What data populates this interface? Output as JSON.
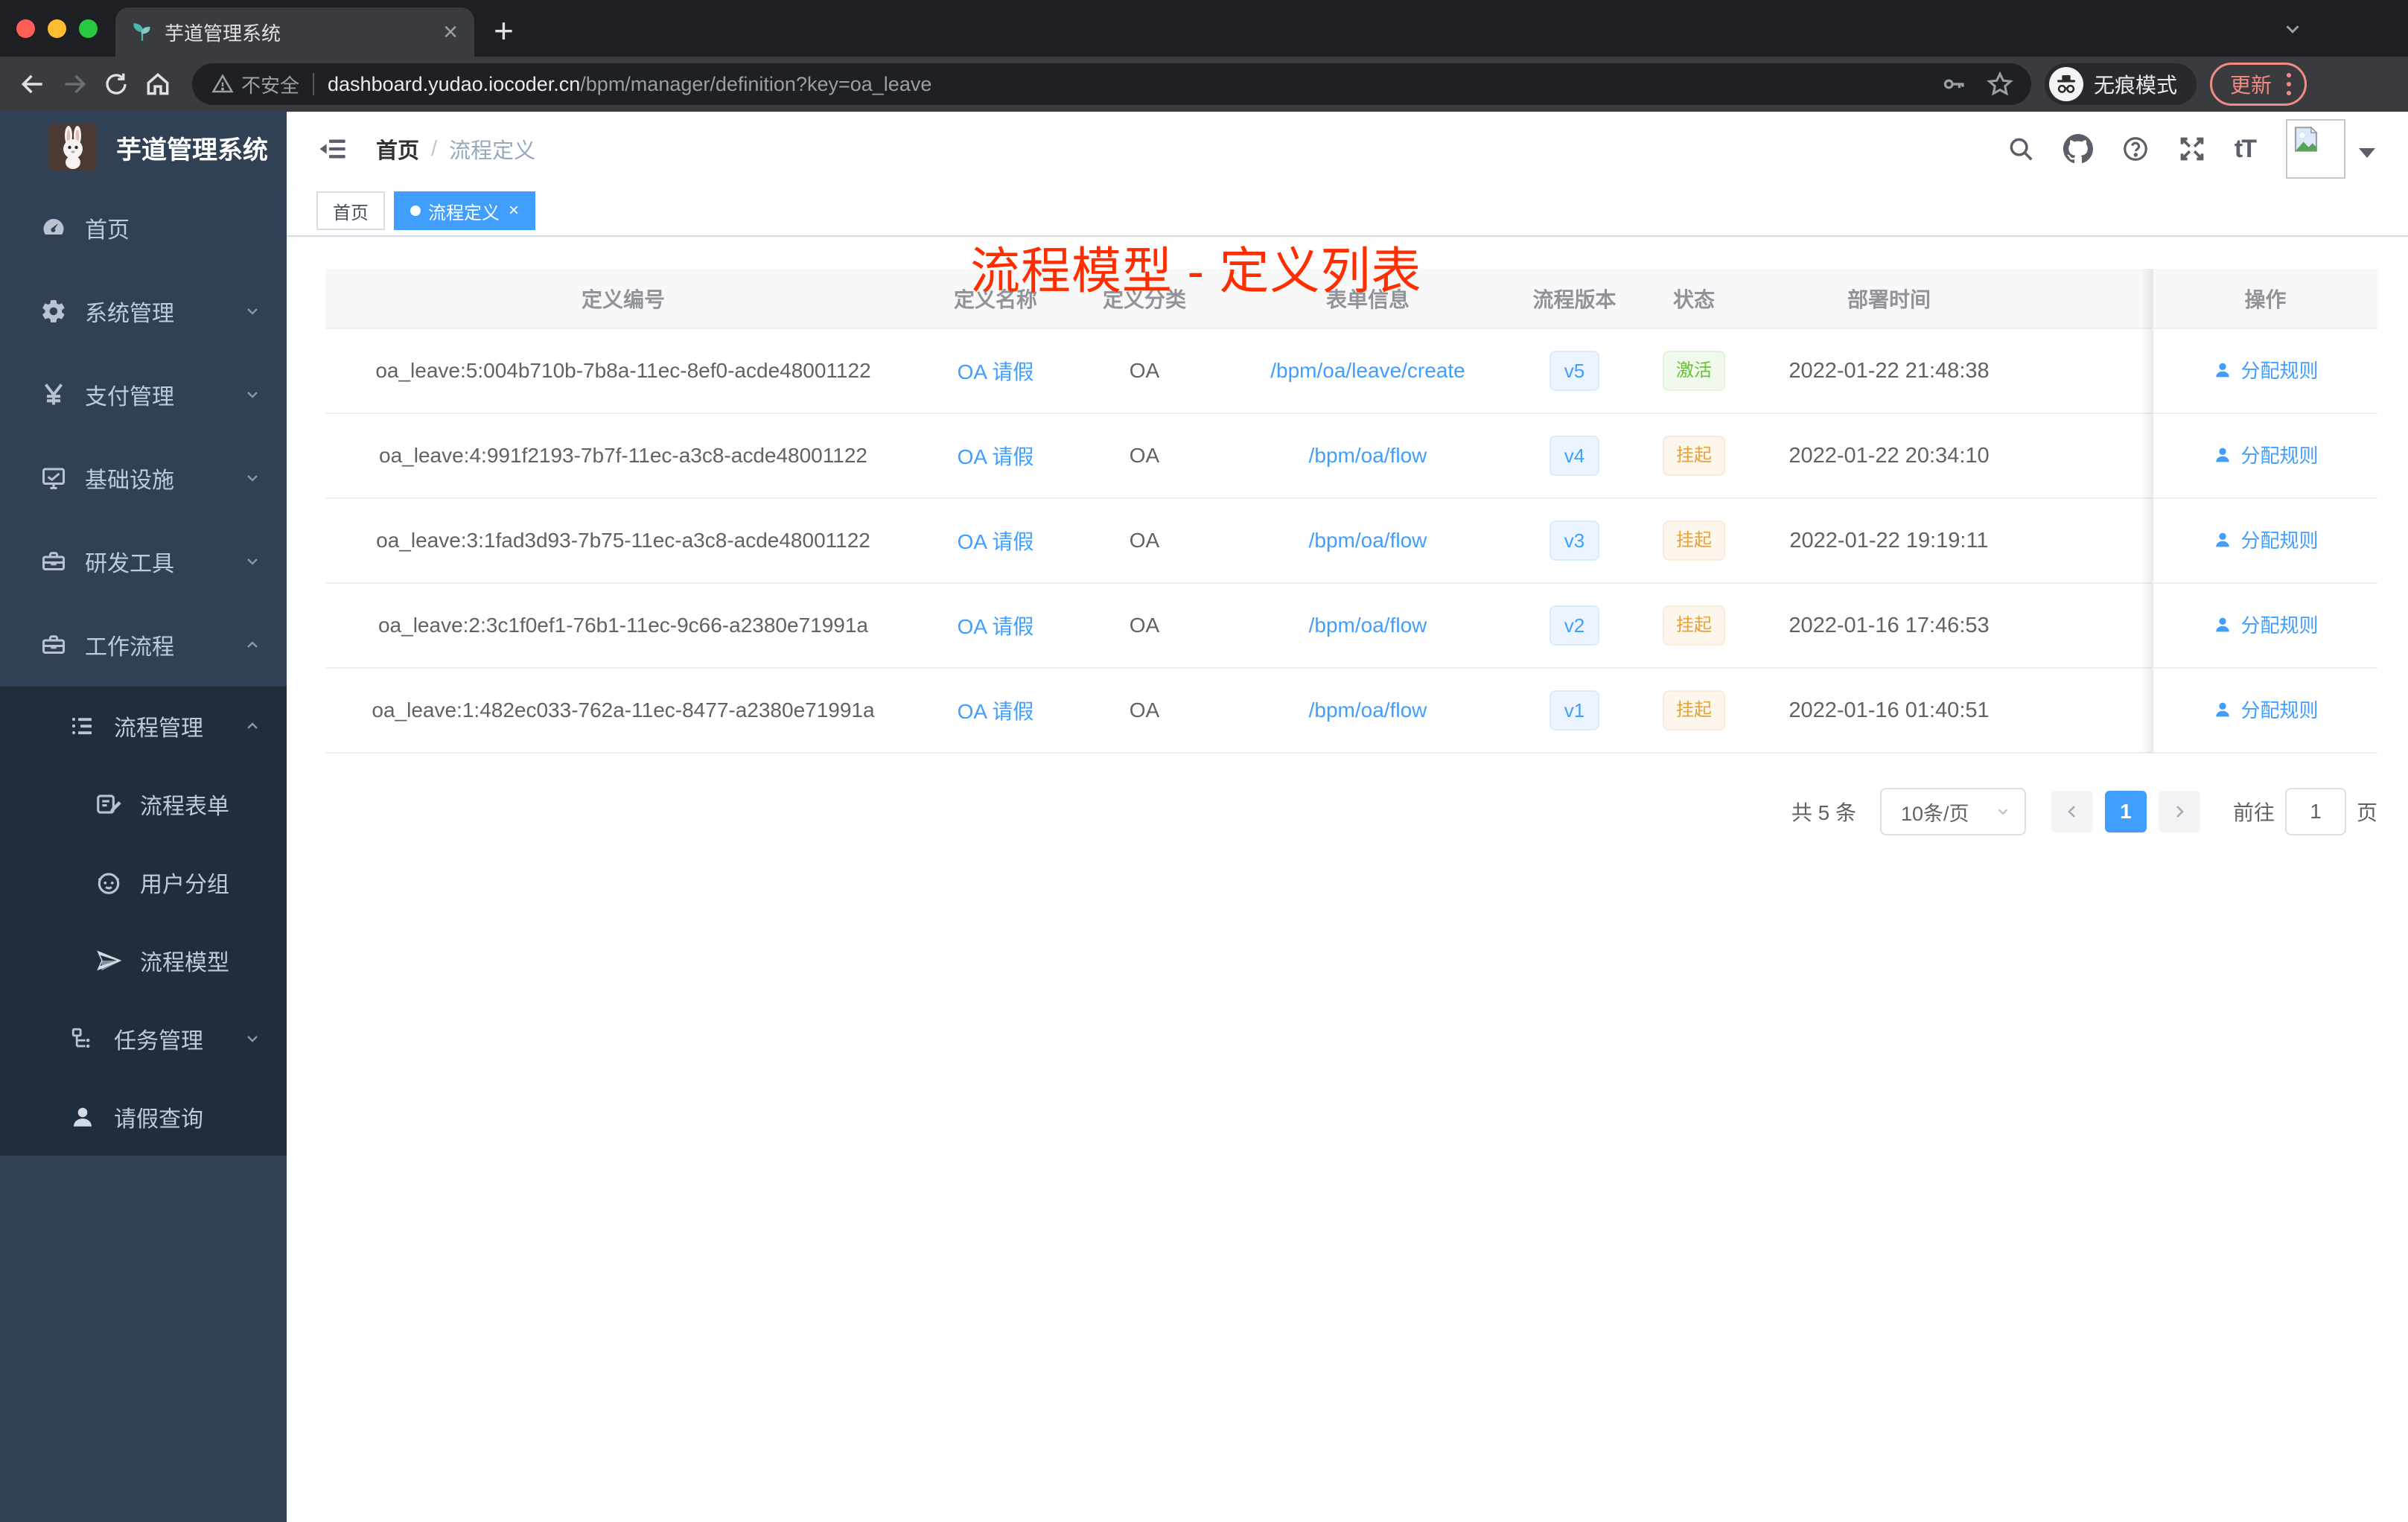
{
  "browser": {
    "tab_title": "芋道管理系统",
    "new_tab_glyph": "+",
    "close_glyph": "×",
    "security_label": "不安全",
    "url_host": "dashboard.yudao.iocoder.cn",
    "url_path": "/bpm/manager/definition?key=oa_leave",
    "incognito_label": "无痕模式",
    "update_label": "更新"
  },
  "sidebar": {
    "logo_title": "芋道管理系统",
    "items": [
      {
        "label": "首页"
      },
      {
        "label": "系统管理"
      },
      {
        "label": "支付管理"
      },
      {
        "label": "基础设施"
      },
      {
        "label": "研发工具"
      },
      {
        "label": "工作流程"
      },
      {
        "label": "流程管理"
      },
      {
        "label": "流程表单"
      },
      {
        "label": "用户分组"
      },
      {
        "label": "流程模型"
      },
      {
        "label": "任务管理"
      },
      {
        "label": "请假查询"
      }
    ]
  },
  "header": {
    "breadcrumb_home": "首页",
    "breadcrumb_sep": "/",
    "breadcrumb_current": "流程定义"
  },
  "annotation_title": "流程模型 - 定义列表",
  "tags": {
    "home": "首页",
    "active": "流程定义",
    "active_close": "×"
  },
  "table": {
    "columns": [
      "定义编号",
      "定义名称",
      "定义分类",
      "表单信息",
      "流程版本",
      "状态",
      "部署时间",
      "操作"
    ],
    "action_label": "分配规则",
    "rows": [
      {
        "id": "oa_leave:5:004b710b-7b8a-11ec-8ef0-acde48001122",
        "name": "OA 请假",
        "category": "OA",
        "form": "/bpm/oa/leave/create",
        "version": "v5",
        "status": "激活",
        "status_type": "active",
        "time": "2022-01-22 21:48:38"
      },
      {
        "id": "oa_leave:4:991f2193-7b7f-11ec-a3c8-acde48001122",
        "name": "OA 请假",
        "category": "OA",
        "form": "/bpm/oa/flow",
        "version": "v4",
        "status": "挂起",
        "status_type": "suspended",
        "time": "2022-01-22 20:34:10"
      },
      {
        "id": "oa_leave:3:1fad3d93-7b75-11ec-a3c8-acde48001122",
        "name": "OA 请假",
        "category": "OA",
        "form": "/bpm/oa/flow",
        "version": "v3",
        "status": "挂起",
        "status_type": "suspended",
        "time": "2022-01-22 19:19:11"
      },
      {
        "id": "oa_leave:2:3c1f0ef1-76b1-11ec-9c66-a2380e71991a",
        "name": "OA 请假",
        "category": "OA",
        "form": "/bpm/oa/flow",
        "version": "v2",
        "status": "挂起",
        "status_type": "suspended",
        "time": "2022-01-16 17:46:53"
      },
      {
        "id": "oa_leave:1:482ec033-762a-11ec-8477-a2380e71991a",
        "name": "OA 请假",
        "category": "OA",
        "form": "/bpm/oa/flow",
        "version": "v1",
        "status": "挂起",
        "status_type": "suspended",
        "time": "2022-01-16 01:40:51"
      }
    ]
  },
  "pagination": {
    "total": "共 5 条",
    "page_size": "10条/页",
    "current_page": "1",
    "goto_label": "前往",
    "goto_value": "1",
    "page_label": "页"
  },
  "colors": {
    "accent": "#409eff",
    "annotation_red": "#ff2d00",
    "status_active": "#67c23a",
    "status_suspended": "#e6a23c",
    "sidebar_bg": "#304156",
    "submenu_bg": "#1f2d3d"
  }
}
